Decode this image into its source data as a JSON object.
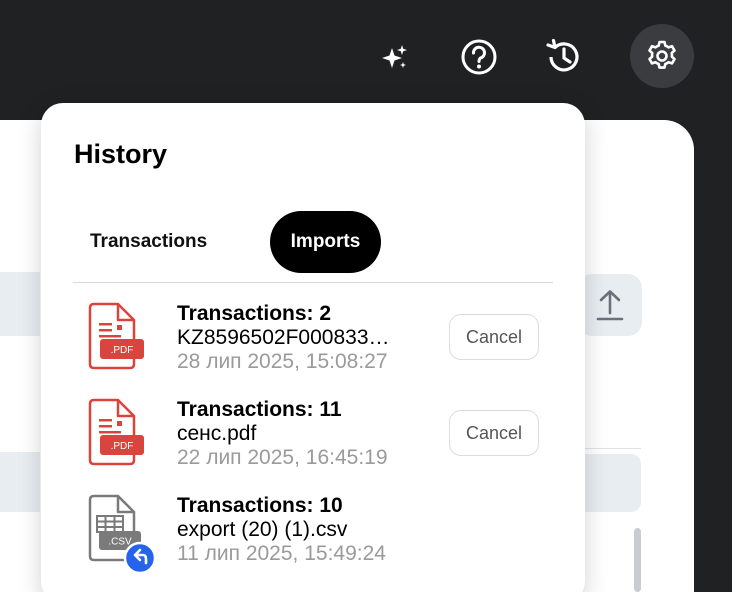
{
  "toolbar": {
    "icons": [
      "sparkle-icon",
      "help-icon",
      "history-icon",
      "settings-icon"
    ]
  },
  "history": {
    "title": "History",
    "tabs": [
      {
        "label": "Transactions",
        "active": false
      },
      {
        "label": "Imports",
        "active": true
      }
    ],
    "items": [
      {
        "title": "Transactions: 2",
        "name": "KZ8596502F000833…",
        "date": "28 лип 2025, 15:08:27",
        "type": "PDF",
        "action": "Cancel"
      },
      {
        "title": "Transactions: 11",
        "name": "сенс.pdf",
        "date": "22 лип 2025, 16:45:19",
        "type": "PDF",
        "action": "Cancel"
      },
      {
        "title": "Transactions: 10",
        "name": "export (20) (1).csv",
        "date": "11 лип 2025, 15:49:24",
        "type": "CSV",
        "action": ""
      }
    ]
  },
  "colors": {
    "pdf": "#d9453c",
    "csv": "#7a7a7a",
    "undo_badge": "#2563eb",
    "dark_bg": "#1f2123"
  }
}
